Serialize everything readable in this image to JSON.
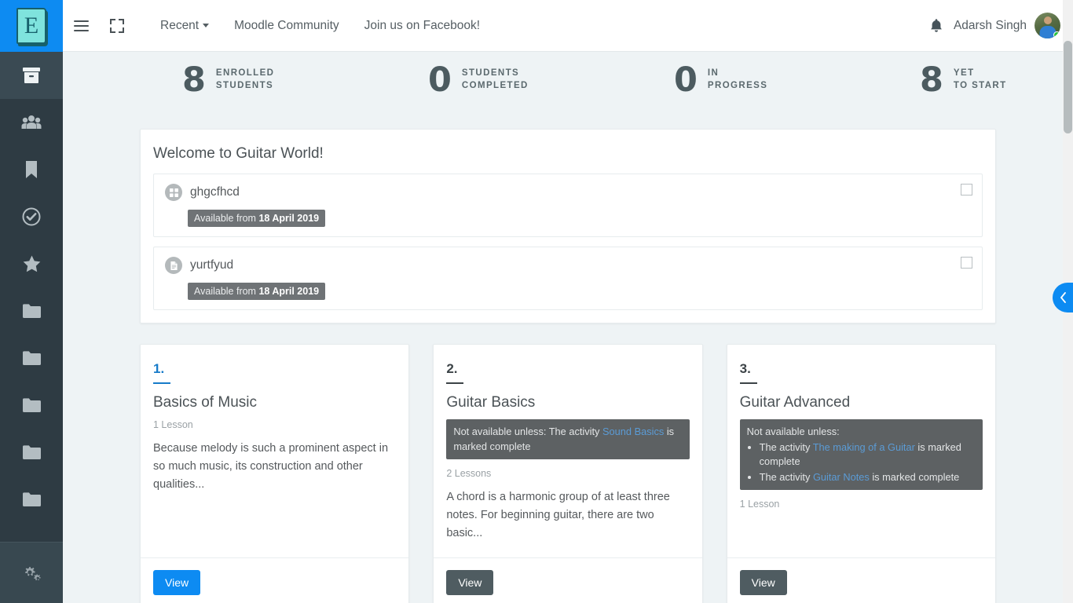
{
  "brand": {
    "logo_letter": "E",
    "logo_bg": "#0d8bf2",
    "logo_fg": "#7fe3dd"
  },
  "topbar": {
    "menu_icon": "hamburger-icon",
    "expand_icon": "fullscreen-icon",
    "links": [
      {
        "label": "Recent",
        "has_caret": true
      },
      {
        "label": "Moodle Community",
        "has_caret": false
      },
      {
        "label": "Join us on Facebook!",
        "has_caret": false
      }
    ],
    "bell_icon": "bell-icon",
    "user_name": "Adarsh Singh",
    "avatar_status": "online"
  },
  "sidebar": {
    "items": [
      {
        "icon": "archive-box-icon",
        "active": true
      },
      {
        "icon": "users-group-icon",
        "active": false
      },
      {
        "icon": "bookmark-icon",
        "active": false
      },
      {
        "icon": "check-circle-icon",
        "active": false
      },
      {
        "icon": "star-icon",
        "active": false
      },
      {
        "icon": "folder-icon",
        "active": false
      },
      {
        "icon": "folder-icon",
        "active": false
      },
      {
        "icon": "folder-icon",
        "active": false
      },
      {
        "icon": "folder-icon",
        "active": false
      },
      {
        "icon": "folder-icon",
        "active": false
      }
    ],
    "bottom": {
      "icon": "gears-settings-icon"
    }
  },
  "stats": [
    {
      "value": "8",
      "line1": "ENROLLED",
      "line2": "STUDENTS"
    },
    {
      "value": "0",
      "line1": "STUDENTS",
      "line2": "COMPLETED"
    },
    {
      "value": "0",
      "line1": "IN",
      "line2": "PROGRESS"
    },
    {
      "value": "8",
      "line1": "YET",
      "line2": "TO START"
    }
  ],
  "welcome": {
    "title": "Welcome to Guitar World!",
    "activities": [
      {
        "icon": "quiz-icon",
        "name": "ghgcfhcd",
        "badge_prefix": "Available from ",
        "badge_date": "18 April 2019",
        "checked": false
      },
      {
        "icon": "page-document-icon",
        "name": "yurtfyud",
        "badge_prefix": "Available from ",
        "badge_date": "18 April 2019",
        "checked": false
      }
    ]
  },
  "courses": [
    {
      "number": "1.",
      "title": "Basics of Music",
      "lessons": "1 Lesson",
      "description": "Because melody is such a prominent aspect in so much music, its construction and other qualities...",
      "restriction": null,
      "button_label": "View",
      "button_style": "primary",
      "accent": true
    },
    {
      "number": "2.",
      "title": "Guitar Basics",
      "lessons": "2 Lessons",
      "description": "A chord is a harmonic group of at least three notes. For beginning guitar, there are two basic...",
      "restriction": {
        "heading": "Not available unless: The activity ",
        "link": "Sound Basics",
        "suffix": " is marked complete",
        "items": []
      },
      "button_label": "View",
      "button_style": "muted",
      "accent": false
    },
    {
      "number": "3.",
      "title": "Guitar Advanced",
      "lessons": "1 Lesson",
      "description": "",
      "restriction": {
        "heading": "Not available unless:",
        "link": null,
        "suffix": "",
        "items": [
          {
            "prefix": "The activity ",
            "link": "The making of a Guitar",
            "suffix": " is marked complete"
          },
          {
            "prefix": "The activity ",
            "link": "Guitar Notes",
            "suffix": " is marked complete"
          }
        ]
      },
      "button_label": "View",
      "button_style": "muted",
      "accent": false
    }
  ],
  "right_tab": {
    "icon": "chevron-left-icon"
  },
  "colors": {
    "accent_blue": "#0d8bf2",
    "link_blue": "#5b9bd5",
    "sidebar_bg": "#2e3b43",
    "page_bg": "#eef3f5",
    "restriction_bg": "#5d6163",
    "muted_button": "#4f5c61"
  }
}
